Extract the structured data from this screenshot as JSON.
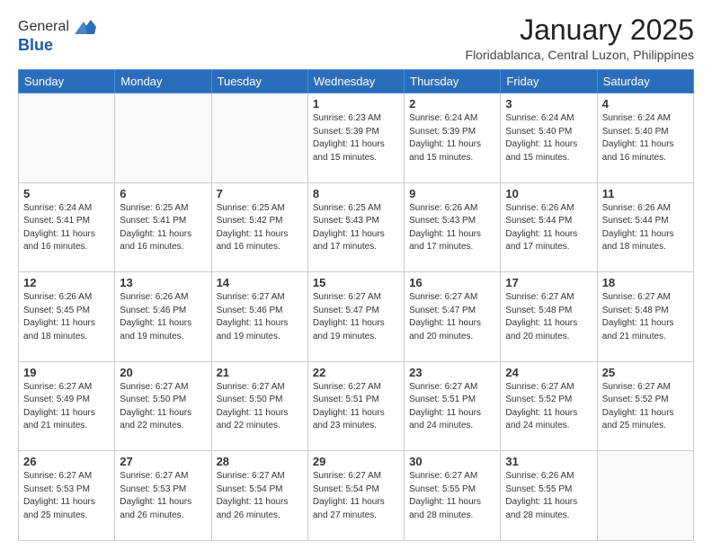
{
  "logo": {
    "general": "General",
    "blue": "Blue"
  },
  "header": {
    "month_year": "January 2025",
    "location": "Floridablanca, Central Luzon, Philippines"
  },
  "days_of_week": [
    "Sunday",
    "Monday",
    "Tuesday",
    "Wednesday",
    "Thursday",
    "Friday",
    "Saturday"
  ],
  "weeks": [
    [
      {
        "day": "",
        "sunrise": "",
        "sunset": "",
        "daylight": ""
      },
      {
        "day": "",
        "sunrise": "",
        "sunset": "",
        "daylight": ""
      },
      {
        "day": "",
        "sunrise": "",
        "sunset": "",
        "daylight": ""
      },
      {
        "day": "1",
        "sunrise": "Sunrise: 6:23 AM",
        "sunset": "Sunset: 5:39 PM",
        "daylight": "Daylight: 11 hours and 15 minutes."
      },
      {
        "day": "2",
        "sunrise": "Sunrise: 6:24 AM",
        "sunset": "Sunset: 5:39 PM",
        "daylight": "Daylight: 11 hours and 15 minutes."
      },
      {
        "day": "3",
        "sunrise": "Sunrise: 6:24 AM",
        "sunset": "Sunset: 5:40 PM",
        "daylight": "Daylight: 11 hours and 15 minutes."
      },
      {
        "day": "4",
        "sunrise": "Sunrise: 6:24 AM",
        "sunset": "Sunset: 5:40 PM",
        "daylight": "Daylight: 11 hours and 16 minutes."
      }
    ],
    [
      {
        "day": "5",
        "sunrise": "Sunrise: 6:24 AM",
        "sunset": "Sunset: 5:41 PM",
        "daylight": "Daylight: 11 hours and 16 minutes."
      },
      {
        "day": "6",
        "sunrise": "Sunrise: 6:25 AM",
        "sunset": "Sunset: 5:41 PM",
        "daylight": "Daylight: 11 hours and 16 minutes."
      },
      {
        "day": "7",
        "sunrise": "Sunrise: 6:25 AM",
        "sunset": "Sunset: 5:42 PM",
        "daylight": "Daylight: 11 hours and 16 minutes."
      },
      {
        "day": "8",
        "sunrise": "Sunrise: 6:25 AM",
        "sunset": "Sunset: 5:43 PM",
        "daylight": "Daylight: 11 hours and 17 minutes."
      },
      {
        "day": "9",
        "sunrise": "Sunrise: 6:26 AM",
        "sunset": "Sunset: 5:43 PM",
        "daylight": "Daylight: 11 hours and 17 minutes."
      },
      {
        "day": "10",
        "sunrise": "Sunrise: 6:26 AM",
        "sunset": "Sunset: 5:44 PM",
        "daylight": "Daylight: 11 hours and 17 minutes."
      },
      {
        "day": "11",
        "sunrise": "Sunrise: 6:26 AM",
        "sunset": "Sunset: 5:44 PM",
        "daylight": "Daylight: 11 hours and 18 minutes."
      }
    ],
    [
      {
        "day": "12",
        "sunrise": "Sunrise: 6:26 AM",
        "sunset": "Sunset: 5:45 PM",
        "daylight": "Daylight: 11 hours and 18 minutes."
      },
      {
        "day": "13",
        "sunrise": "Sunrise: 6:26 AM",
        "sunset": "Sunset: 5:46 PM",
        "daylight": "Daylight: 11 hours and 19 minutes."
      },
      {
        "day": "14",
        "sunrise": "Sunrise: 6:27 AM",
        "sunset": "Sunset: 5:46 PM",
        "daylight": "Daylight: 11 hours and 19 minutes."
      },
      {
        "day": "15",
        "sunrise": "Sunrise: 6:27 AM",
        "sunset": "Sunset: 5:47 PM",
        "daylight": "Daylight: 11 hours and 19 minutes."
      },
      {
        "day": "16",
        "sunrise": "Sunrise: 6:27 AM",
        "sunset": "Sunset: 5:47 PM",
        "daylight": "Daylight: 11 hours and 20 minutes."
      },
      {
        "day": "17",
        "sunrise": "Sunrise: 6:27 AM",
        "sunset": "Sunset: 5:48 PM",
        "daylight": "Daylight: 11 hours and 20 minutes."
      },
      {
        "day": "18",
        "sunrise": "Sunrise: 6:27 AM",
        "sunset": "Sunset: 5:48 PM",
        "daylight": "Daylight: 11 hours and 21 minutes."
      }
    ],
    [
      {
        "day": "19",
        "sunrise": "Sunrise: 6:27 AM",
        "sunset": "Sunset: 5:49 PM",
        "daylight": "Daylight: 11 hours and 21 minutes."
      },
      {
        "day": "20",
        "sunrise": "Sunrise: 6:27 AM",
        "sunset": "Sunset: 5:50 PM",
        "daylight": "Daylight: 11 hours and 22 minutes."
      },
      {
        "day": "21",
        "sunrise": "Sunrise: 6:27 AM",
        "sunset": "Sunset: 5:50 PM",
        "daylight": "Daylight: 11 hours and 22 minutes."
      },
      {
        "day": "22",
        "sunrise": "Sunrise: 6:27 AM",
        "sunset": "Sunset: 5:51 PM",
        "daylight": "Daylight: 11 hours and 23 minutes."
      },
      {
        "day": "23",
        "sunrise": "Sunrise: 6:27 AM",
        "sunset": "Sunset: 5:51 PM",
        "daylight": "Daylight: 11 hours and 24 minutes."
      },
      {
        "day": "24",
        "sunrise": "Sunrise: 6:27 AM",
        "sunset": "Sunset: 5:52 PM",
        "daylight": "Daylight: 11 hours and 24 minutes."
      },
      {
        "day": "25",
        "sunrise": "Sunrise: 6:27 AM",
        "sunset": "Sunset: 5:52 PM",
        "daylight": "Daylight: 11 hours and 25 minutes."
      }
    ],
    [
      {
        "day": "26",
        "sunrise": "Sunrise: 6:27 AM",
        "sunset": "Sunset: 5:53 PM",
        "daylight": "Daylight: 11 hours and 25 minutes."
      },
      {
        "day": "27",
        "sunrise": "Sunrise: 6:27 AM",
        "sunset": "Sunset: 5:53 PM",
        "daylight": "Daylight: 11 hours and 26 minutes."
      },
      {
        "day": "28",
        "sunrise": "Sunrise: 6:27 AM",
        "sunset": "Sunset: 5:54 PM",
        "daylight": "Daylight: 11 hours and 26 minutes."
      },
      {
        "day": "29",
        "sunrise": "Sunrise: 6:27 AM",
        "sunset": "Sunset: 5:54 PM",
        "daylight": "Daylight: 11 hours and 27 minutes."
      },
      {
        "day": "30",
        "sunrise": "Sunrise: 6:27 AM",
        "sunset": "Sunset: 5:55 PM",
        "daylight": "Daylight: 11 hours and 28 minutes."
      },
      {
        "day": "31",
        "sunrise": "Sunrise: 6:26 AM",
        "sunset": "Sunset: 5:55 PM",
        "daylight": "Daylight: 11 hours and 28 minutes."
      },
      {
        "day": "",
        "sunrise": "",
        "sunset": "",
        "daylight": ""
      }
    ]
  ]
}
